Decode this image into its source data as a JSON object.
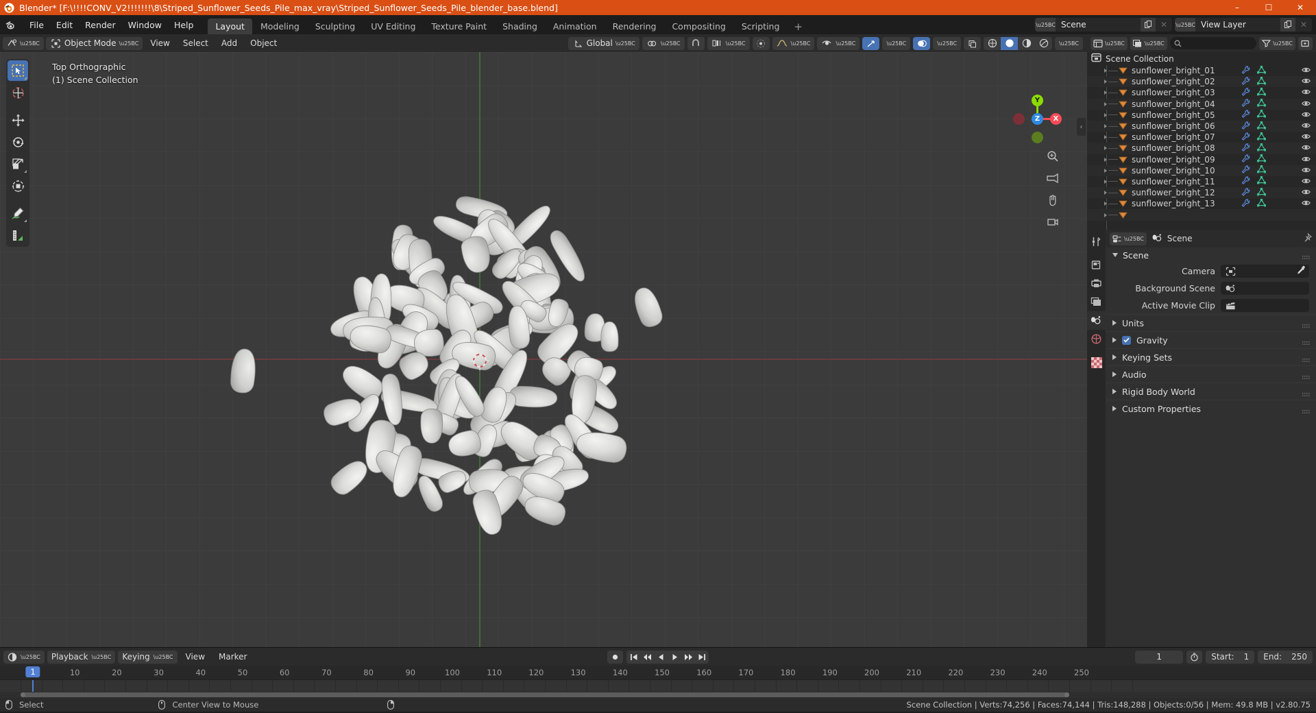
{
  "window": {
    "title": "Blender* [F:\\!!!!CONV_V2!!!!!!!\\8\\Striped_Sunflower_Seeds_Pile_max_vray\\Striped_Sunflower_Seeds_Pile_blender_base.blend]",
    "app_icon": "blender-logo-icon",
    "minimize": "–",
    "maximize": "☐",
    "close": "✕",
    "titlebar_color": "#d94f14"
  },
  "topbar": {
    "logo": "blender-logo-icon",
    "menus": [
      "File",
      "Edit",
      "Render",
      "Window",
      "Help"
    ],
    "workspaces": [
      {
        "label": "Layout",
        "active": true
      },
      {
        "label": "Modeling",
        "active": false
      },
      {
        "label": "Sculpting",
        "active": false
      },
      {
        "label": "UV Editing",
        "active": false
      },
      {
        "label": "Texture Paint",
        "active": false
      },
      {
        "label": "Shading",
        "active": false
      },
      {
        "label": "Animation",
        "active": false
      },
      {
        "label": "Rendering",
        "active": false
      },
      {
        "label": "Compositing",
        "active": false
      },
      {
        "label": "Scripting",
        "active": false
      }
    ],
    "add_workspace": "+",
    "scene": {
      "icon": "scene-icon",
      "name": "Scene",
      "new_btn": "copy-icon",
      "unlink_btn": "✕"
    },
    "view_layer": {
      "icon": "view-layer-icon",
      "name": "View Layer",
      "new_btn": "copy-icon",
      "unlink_btn": "✕"
    }
  },
  "viewport": {
    "header": {
      "editor_type": "editor-type-3dview-icon",
      "mode": "Object Mode",
      "menus": [
        "View",
        "Select",
        "Add",
        "Object"
      ],
      "transform_orientation": "Global",
      "snap_icon": "magnet-icon",
      "proportional_icon": "proportional-edit-icon",
      "falloff_icon": "smooth-falloff-icon",
      "overlays_visibility": "visibility-icon",
      "gizmo_icon": "gizmo-icon",
      "overlay_icon": "overlays-icon",
      "xray_icon": "xray-icon",
      "shading": [
        {
          "name": "wireframe-shading-icon",
          "selected": false
        },
        {
          "name": "solid-shading-icon",
          "selected": true
        },
        {
          "name": "material-preview-shading-icon",
          "selected": false
        },
        {
          "name": "rendered-shading-icon",
          "selected": false
        }
      ]
    },
    "overlay_text": {
      "view": "Top Orthographic",
      "collection": "(1) Scene Collection"
    },
    "tools": [
      {
        "name": "tweak-select-box-tool",
        "active": true,
        "has_submenu": true
      },
      {
        "name": "cursor-tool",
        "active": false,
        "has_submenu": false
      },
      {
        "name": "move-tool",
        "active": false,
        "has_submenu": false
      },
      {
        "name": "rotate-tool",
        "active": false,
        "has_submenu": false
      },
      {
        "name": "scale-tool",
        "active": false,
        "has_submenu": true
      },
      {
        "name": "transform-tool",
        "active": false,
        "has_submenu": false
      },
      {
        "name": "annotate-tool",
        "active": false,
        "has_submenu": true
      },
      {
        "name": "measure-tool",
        "active": false,
        "has_submenu": false
      }
    ],
    "gizmo": {
      "axes": [
        "X",
        "Y",
        "Z"
      ],
      "x_color": "#fc4b58",
      "y_color": "#8bdc00",
      "z_color": "#2f8ae0"
    },
    "nav_buttons": [
      "zoom-icon",
      "camera-perspective-icon",
      "hand-move-icon",
      "camera-view-icon"
    ],
    "collapse_arrow": "‹"
  },
  "outliner": {
    "header": {
      "editor_type": "editor-type-outliner-icon",
      "display_mode": "view-layer-icon",
      "filter_icon": "filter-icon",
      "new_collection_icon": "new-collection-icon",
      "search_icon": "search-icon",
      "search_placeholder": ""
    },
    "root": {
      "icon": "scene-collection-icon",
      "label": "Scene Collection"
    },
    "rows": [
      "sunflower_bright_01",
      "sunflower_bright_02",
      "sunflower_bright_03",
      "sunflower_bright_04",
      "sunflower_bright_05",
      "sunflower_bright_06",
      "sunflower_bright_07",
      "sunflower_bright_08",
      "sunflower_bright_09",
      "sunflower_bright_10",
      "sunflower_bright_11",
      "sunflower_bright_12",
      "sunflower_bright_13"
    ],
    "row_icons": {
      "expand": "disclosure-triangle-icon",
      "object": "object-mesh-icon",
      "modifier": "wrench-icon",
      "mesh_data": "mesh-data-icon",
      "visibility": "eye-icon"
    }
  },
  "properties": {
    "tabs": [
      {
        "name": "tool-properties-tab",
        "active": false
      },
      {
        "name": "render-properties-tab",
        "active": false
      },
      {
        "name": "output-properties-tab",
        "active": false
      },
      {
        "name": "view-layer-properties-tab",
        "active": false
      },
      {
        "name": "scene-properties-tab",
        "active": true
      },
      {
        "name": "world-properties-tab",
        "active": false
      },
      {
        "name": "texture-properties-tab",
        "active": false
      }
    ],
    "header": {
      "editor_icon": "editor-type-properties-icon",
      "breadcrumb_icon": "scene-icon",
      "breadcrumb": "Scene",
      "pin_icon": "pin-icon"
    },
    "panel_title": "Scene",
    "fields": [
      {
        "label": "Camera",
        "icon": "camera-data-icon",
        "value": "",
        "eyedropper": true
      },
      {
        "label": "Background Scene",
        "icon": "scene-icon",
        "value": "",
        "eyedropper": false
      },
      {
        "label": "Active Movie Clip",
        "icon": "movie-clip-icon",
        "value": "",
        "eyedropper": false
      }
    ],
    "sub_panels": [
      {
        "label": "Units",
        "checkbox": null
      },
      {
        "label": "Gravity",
        "checkbox": true
      },
      {
        "label": "Keying Sets",
        "checkbox": null
      },
      {
        "label": "Audio",
        "checkbox": null
      },
      {
        "label": "Rigid Body World",
        "checkbox": null
      },
      {
        "label": "Custom Properties",
        "checkbox": null
      }
    ]
  },
  "timeline": {
    "editor_type": "editor-type-timeline-icon",
    "menus": [
      {
        "label": "Playback",
        "dropdown": true
      },
      {
        "label": "Keying",
        "dropdown": true
      },
      {
        "label": "View",
        "dropdown": false
      },
      {
        "label": "Marker",
        "dropdown": false
      }
    ],
    "record_btn": "auto-keying-record-icon",
    "playback_buttons": [
      "jump-to-start-icon",
      "jump-to-prev-keyframe-icon",
      "play-reverse-icon",
      "play-icon",
      "jump-to-next-keyframe-icon",
      "jump-to-end-icon"
    ],
    "current_frame": "1",
    "use_preview_range_icon": "stopwatch-icon",
    "start_label": "Start:",
    "start_value": "1",
    "end_label": "End:",
    "end_value": "250",
    "ruler_ticks": [
      "10",
      "20",
      "30",
      "40",
      "50",
      "60",
      "70",
      "80",
      "90",
      "100",
      "110",
      "120",
      "130",
      "140",
      "150",
      "160",
      "170",
      "180",
      "190",
      "200",
      "210",
      "220",
      "230",
      "240",
      "250"
    ],
    "playhead_label": "1",
    "expand_arrow": "›"
  },
  "statusbar": {
    "left": [
      {
        "icon": "mouse-left-icon",
        "label": "Select"
      },
      {
        "icon": "mouse-middle-icon",
        "label": "Center View to Mouse"
      },
      {
        "icon": "mouse-right-icon",
        "label": ""
      }
    ],
    "stats": "Scene Collection | Verts:74,256 | Faces:74,144 | Tris:148,288 | Objects:0/56 | Mem: 49.8 MB | v2.80.75"
  }
}
